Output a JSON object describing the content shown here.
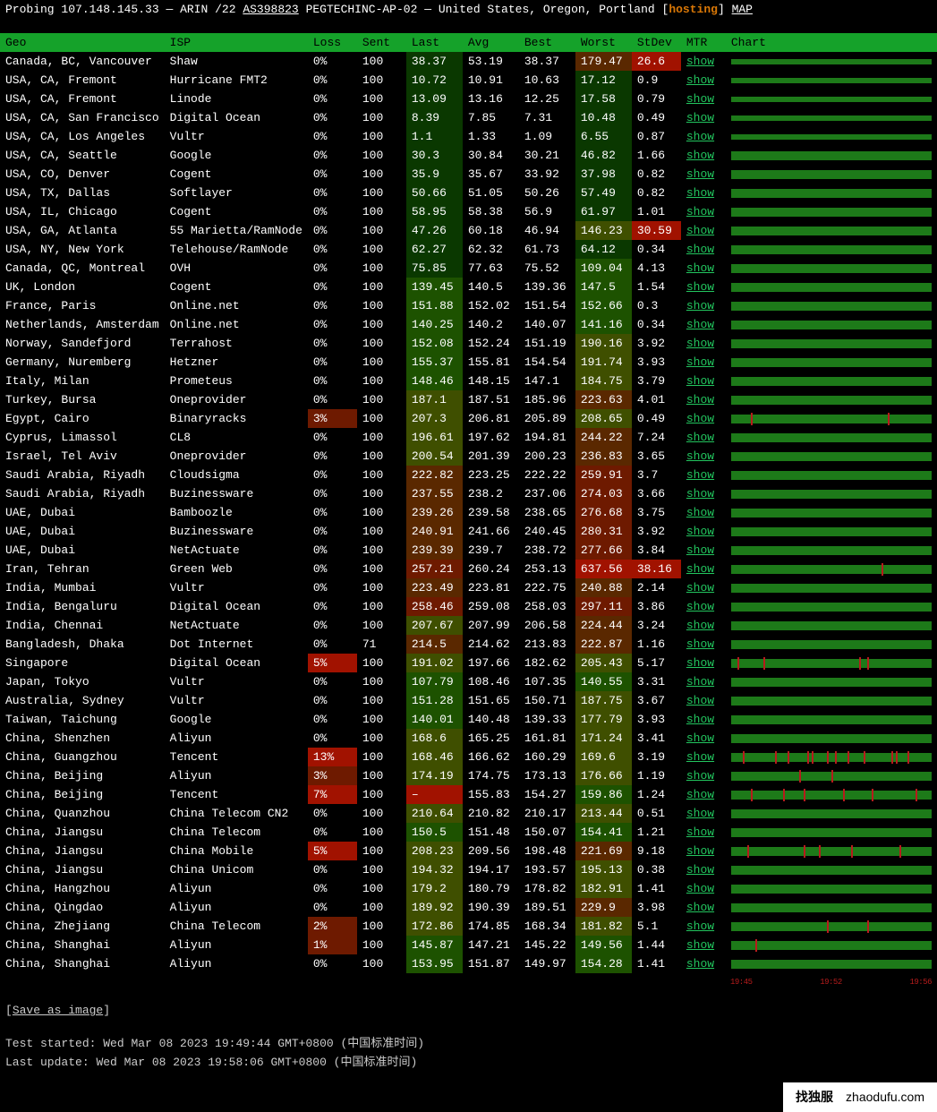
{
  "header": {
    "probing_label": "Probing",
    "ip": "107.148.145.33",
    "dash": "—",
    "rir": "ARIN",
    "prefix": "/22",
    "asn": "AS398823",
    "org": "PEGTECHINC-AP-02",
    "country": "United States",
    "region": "Oregon",
    "city": "Portland",
    "hosting_label": "hosting",
    "map_label": "MAP"
  },
  "columns": {
    "geo": "Geo",
    "isp": "ISP",
    "loss": "Loss",
    "sent": "Sent",
    "last": "Last",
    "avg": "Avg",
    "best": "Best",
    "worst": "Worst",
    "stdev": "StDev",
    "mtr": "MTR",
    "chart": "Chart"
  },
  "mtr_label": "show",
  "rows": [
    {
      "geo": "Canada, BC, Vancouver",
      "isp": "Shaw",
      "loss": "0%",
      "lossh": "h0",
      "sent": "100",
      "last": "38.37",
      "lasth": "h1",
      "avg": "53.19",
      "best": "38.37",
      "worst": "179.47",
      "worsth": "h4",
      "stdev": "26.6",
      "stdevh": "h6",
      "spikes": []
    },
    {
      "geo": "USA, CA, Fremont",
      "isp": "Hurricane FMT2",
      "loss": "0%",
      "lossh": "h0",
      "sent": "100",
      "last": "10.72",
      "lasth": "h1",
      "avg": "10.91",
      "best": "10.63",
      "worst": "17.12",
      "worsth": "h1",
      "stdev": "0.9",
      "stdevh": "h0",
      "spikes": []
    },
    {
      "geo": "USA, CA, Fremont",
      "isp": "Linode",
      "loss": "0%",
      "lossh": "h0",
      "sent": "100",
      "last": "13.09",
      "lasth": "h1",
      "avg": "13.16",
      "best": "12.25",
      "worst": "17.58",
      "worsth": "h1",
      "stdev": "0.79",
      "stdevh": "h0",
      "spikes": []
    },
    {
      "geo": "USA, CA, San Francisco",
      "isp": "Digital Ocean",
      "loss": "0%",
      "lossh": "h0",
      "sent": "100",
      "last": "8.39",
      "lasth": "h1",
      "avg": "7.85",
      "best": "7.31",
      "worst": "10.48",
      "worsth": "h1",
      "stdev": "0.49",
      "stdevh": "h0",
      "spikes": []
    },
    {
      "geo": "USA, CA, Los Angeles",
      "isp": "Vultr",
      "loss": "0%",
      "lossh": "h0",
      "sent": "100",
      "last": "1.1",
      "lasth": "h1",
      "avg": "1.33",
      "best": "1.09",
      "worst": "6.55",
      "worsth": "h1",
      "stdev": "0.87",
      "stdevh": "h0",
      "spikes": []
    },
    {
      "geo": "USA, CA, Seattle",
      "isp": "Google",
      "loss": "0%",
      "lossh": "h0",
      "sent": "100",
      "last": "30.3",
      "lasth": "h1",
      "avg": "30.84",
      "best": "30.21",
      "worst": "46.82",
      "worsth": "h1",
      "stdev": "1.66",
      "stdevh": "h0",
      "spikes": []
    },
    {
      "geo": "USA, CO, Denver",
      "isp": "Cogent",
      "loss": "0%",
      "lossh": "h0",
      "sent": "100",
      "last": "35.9",
      "lasth": "h1",
      "avg": "35.67",
      "best": "33.92",
      "worst": "37.98",
      "worsth": "h1",
      "stdev": "0.82",
      "stdevh": "h0",
      "spikes": []
    },
    {
      "geo": "USA, TX, Dallas",
      "isp": "Softlayer",
      "loss": "0%",
      "lossh": "h0",
      "sent": "100",
      "last": "50.66",
      "lasth": "h1",
      "avg": "51.05",
      "best": "50.26",
      "worst": "57.49",
      "worsth": "h1",
      "stdev": "0.82",
      "stdevh": "h0",
      "spikes": []
    },
    {
      "geo": "USA, IL, Chicago",
      "isp": "Cogent",
      "loss": "0%",
      "lossh": "h0",
      "sent": "100",
      "last": "58.95",
      "lasth": "h1",
      "avg": "58.38",
      "best": "56.9",
      "worst": "61.97",
      "worsth": "h1",
      "stdev": "1.01",
      "stdevh": "h0",
      "spikes": []
    },
    {
      "geo": "USA, GA, Atlanta",
      "isp": "55 Marietta/RamNode",
      "loss": "0%",
      "lossh": "h0",
      "sent": "100",
      "last": "47.26",
      "lasth": "h1",
      "avg": "60.18",
      "best": "46.94",
      "worst": "146.23",
      "worsth": "h3",
      "stdev": "30.59",
      "stdevh": "h6",
      "spikes": []
    },
    {
      "geo": "USA, NY, New York",
      "isp": "Telehouse/RamNode",
      "loss": "0%",
      "lossh": "h0",
      "sent": "100",
      "last": "62.27",
      "lasth": "h1",
      "avg": "62.32",
      "best": "61.73",
      "worst": "64.12",
      "worsth": "h1",
      "stdev": "0.34",
      "stdevh": "h0",
      "spikes": []
    },
    {
      "geo": "Canada, QC, Montreal",
      "isp": "OVH",
      "loss": "0%",
      "lossh": "h0",
      "sent": "100",
      "last": "75.85",
      "lasth": "h1",
      "avg": "77.63",
      "best": "75.52",
      "worst": "109.04",
      "worsth": "h2",
      "stdev": "4.13",
      "stdevh": "h0",
      "spikes": []
    },
    {
      "geo": "UK, London",
      "isp": "Cogent",
      "loss": "0%",
      "lossh": "h0",
      "sent": "100",
      "last": "139.45",
      "lasth": "h2",
      "avg": "140.5",
      "best": "139.36",
      "worst": "147.5",
      "worsth": "h2",
      "stdev": "1.54",
      "stdevh": "h0",
      "spikes": []
    },
    {
      "geo": "France, Paris",
      "isp": "Online.net",
      "loss": "0%",
      "lossh": "h0",
      "sent": "100",
      "last": "151.88",
      "lasth": "h2",
      "avg": "152.02",
      "best": "151.54",
      "worst": "152.66",
      "worsth": "h2",
      "stdev": "0.3",
      "stdevh": "h0",
      "spikes": []
    },
    {
      "geo": "Netherlands, Amsterdam",
      "isp": "Online.net",
      "loss": "0%",
      "lossh": "h0",
      "sent": "100",
      "last": "140.25",
      "lasth": "h2",
      "avg": "140.2",
      "best": "140.07",
      "worst": "141.16",
      "worsth": "h2",
      "stdev": "0.34",
      "stdevh": "h0",
      "spikes": []
    },
    {
      "geo": "Norway, Sandefjord",
      "isp": "Terrahost",
      "loss": "0%",
      "lossh": "h0",
      "sent": "100",
      "last": "152.08",
      "lasth": "h2",
      "avg": "152.24",
      "best": "151.19",
      "worst": "190.16",
      "worsth": "h3",
      "stdev": "3.92",
      "stdevh": "h0",
      "spikes": []
    },
    {
      "geo": "Germany, Nuremberg",
      "isp": "Hetzner",
      "loss": "0%",
      "lossh": "h0",
      "sent": "100",
      "last": "155.37",
      "lasth": "h2",
      "avg": "155.81",
      "best": "154.54",
      "worst": "191.74",
      "worsth": "h3",
      "stdev": "3.93",
      "stdevh": "h0",
      "spikes": []
    },
    {
      "geo": "Italy, Milan",
      "isp": "Prometeus",
      "loss": "0%",
      "lossh": "h0",
      "sent": "100",
      "last": "148.46",
      "lasth": "h2",
      "avg": "148.15",
      "best": "147.1",
      "worst": "184.75",
      "worsth": "h3",
      "stdev": "3.79",
      "stdevh": "h0",
      "spikes": []
    },
    {
      "geo": "Turkey, Bursa",
      "isp": "Oneprovider",
      "loss": "0%",
      "lossh": "h0",
      "sent": "100",
      "last": "187.1",
      "lasth": "h3",
      "avg": "187.51",
      "best": "185.96",
      "worst": "223.63",
      "worsth": "h4",
      "stdev": "4.01",
      "stdevh": "h0",
      "spikes": []
    },
    {
      "geo": "Egypt, Cairo",
      "isp": "Binaryracks",
      "loss": "3%",
      "lossh": "h5",
      "sent": "100",
      "last": "207.3",
      "lasth": "h3",
      "avg": "206.81",
      "best": "205.89",
      "worst": "208.65",
      "worsth": "h3",
      "stdev": "0.49",
      "stdevh": "h0",
      "spikes": [
        10,
        78
      ]
    },
    {
      "geo": "Cyprus, Limassol",
      "isp": "CL8",
      "loss": "0%",
      "lossh": "h0",
      "sent": "100",
      "last": "196.61",
      "lasth": "h3",
      "avg": "197.62",
      "best": "194.81",
      "worst": "244.22",
      "worsth": "h4",
      "stdev": "7.24",
      "stdevh": "h0",
      "spikes": []
    },
    {
      "geo": "Israel, Tel Aviv",
      "isp": "Oneprovider",
      "loss": "0%",
      "lossh": "h0",
      "sent": "100",
      "last": "200.54",
      "lasth": "h3",
      "avg": "201.39",
      "best": "200.23",
      "worst": "236.83",
      "worsth": "h4",
      "stdev": "3.65",
      "stdevh": "h0",
      "spikes": []
    },
    {
      "geo": "Saudi Arabia, Riyadh",
      "isp": "Cloudsigma",
      "loss": "0%",
      "lossh": "h0",
      "sent": "100",
      "last": "222.82",
      "lasth": "h4",
      "avg": "223.25",
      "best": "222.22",
      "worst": "259.91",
      "worsth": "h5",
      "stdev": "3.7",
      "stdevh": "h0",
      "spikes": []
    },
    {
      "geo": "Saudi Arabia, Riyadh",
      "isp": "Buzinessware",
      "loss": "0%",
      "lossh": "h0",
      "sent": "100",
      "last": "237.55",
      "lasth": "h4",
      "avg": "238.2",
      "best": "237.06",
      "worst": "274.03",
      "worsth": "h5",
      "stdev": "3.66",
      "stdevh": "h0",
      "spikes": []
    },
    {
      "geo": "UAE, Dubai",
      "isp": "Bamboozle",
      "loss": "0%",
      "lossh": "h0",
      "sent": "100",
      "last": "239.26",
      "lasth": "h4",
      "avg": "239.58",
      "best": "238.65",
      "worst": "276.68",
      "worsth": "h5",
      "stdev": "3.75",
      "stdevh": "h0",
      "spikes": []
    },
    {
      "geo": "UAE, Dubai",
      "isp": "Buzinessware",
      "loss": "0%",
      "lossh": "h0",
      "sent": "100",
      "last": "240.91",
      "lasth": "h4",
      "avg": "241.66",
      "best": "240.45",
      "worst": "280.31",
      "worsth": "h5",
      "stdev": "3.92",
      "stdevh": "h0",
      "spikes": []
    },
    {
      "geo": "UAE, Dubai",
      "isp": "NetActuate",
      "loss": "0%",
      "lossh": "h0",
      "sent": "100",
      "last": "239.39",
      "lasth": "h4",
      "avg": "239.7",
      "best": "238.72",
      "worst": "277.66",
      "worsth": "h5",
      "stdev": "3.84",
      "stdevh": "h0",
      "spikes": []
    },
    {
      "geo": "Iran, Tehran",
      "isp": "Green Web",
      "loss": "0%",
      "lossh": "h0",
      "sent": "100",
      "last": "257.21",
      "lasth": "h5",
      "avg": "260.24",
      "best": "253.13",
      "worst": "637.56",
      "worsth": "h6",
      "stdev": "38.16",
      "stdevh": "h6",
      "spikes": [
        75
      ]
    },
    {
      "geo": "India, Mumbai",
      "isp": "Vultr",
      "loss": "0%",
      "lossh": "h0",
      "sent": "100",
      "last": "223.49",
      "lasth": "h4",
      "avg": "223.81",
      "best": "222.75",
      "worst": "240.88",
      "worsth": "h4",
      "stdev": "2.14",
      "stdevh": "h0",
      "spikes": []
    },
    {
      "geo": "India, Bengaluru",
      "isp": "Digital Ocean",
      "loss": "0%",
      "lossh": "h0",
      "sent": "100",
      "last": "258.46",
      "lasth": "h5",
      "avg": "259.08",
      "best": "258.03",
      "worst": "297.11",
      "worsth": "h5",
      "stdev": "3.86",
      "stdevh": "h0",
      "spikes": []
    },
    {
      "geo": "India, Chennai",
      "isp": "NetActuate",
      "loss": "0%",
      "lossh": "h0",
      "sent": "100",
      "last": "207.67",
      "lasth": "h3",
      "avg": "207.99",
      "best": "206.58",
      "worst": "224.44",
      "worsth": "h4",
      "stdev": "3.24",
      "stdevh": "h0",
      "spikes": []
    },
    {
      "geo": "Bangladesh, Dhaka",
      "isp": "Dot Internet",
      "loss": "0%",
      "lossh": "h0",
      "sent": "71",
      "last": "214.5",
      "lasth": "h4",
      "avg": "214.62",
      "best": "213.83",
      "worst": "222.87",
      "worsth": "h4",
      "stdev": "1.16",
      "stdevh": "h0",
      "spikes": []
    },
    {
      "geo": "Singapore",
      "isp": "Digital Ocean",
      "loss": "5%",
      "lossh": "h6",
      "sent": "100",
      "last": "191.02",
      "lasth": "h3",
      "avg": "197.66",
      "best": "182.62",
      "worst": "205.43",
      "worsth": "h3",
      "stdev": "5.17",
      "stdevh": "h0",
      "spikes": [
        3,
        16,
        64,
        68
      ]
    },
    {
      "geo": "Japan, Tokyo",
      "isp": "Vultr",
      "loss": "0%",
      "lossh": "h0",
      "sent": "100",
      "last": "107.79",
      "lasth": "h2",
      "avg": "108.46",
      "best": "107.35",
      "worst": "140.55",
      "worsth": "h2",
      "stdev": "3.31",
      "stdevh": "h0",
      "spikes": []
    },
    {
      "geo": "Australia, Sydney",
      "isp": "Vultr",
      "loss": "0%",
      "lossh": "h0",
      "sent": "100",
      "last": "151.28",
      "lasth": "h2",
      "avg": "151.65",
      "best": "150.71",
      "worst": "187.75",
      "worsth": "h3",
      "stdev": "3.67",
      "stdevh": "h0",
      "spikes": []
    },
    {
      "geo": "Taiwan, Taichung",
      "isp": "Google",
      "loss": "0%",
      "lossh": "h0",
      "sent": "100",
      "last": "140.01",
      "lasth": "h2",
      "avg": "140.48",
      "best": "139.33",
      "worst": "177.79",
      "worsth": "h3",
      "stdev": "3.93",
      "stdevh": "h0",
      "spikes": []
    },
    {
      "geo": "China, Shenzhen",
      "isp": "Aliyun",
      "loss": "0%",
      "lossh": "h0",
      "sent": "100",
      "last": "168.6",
      "lasth": "h3",
      "avg": "165.25",
      "best": "161.81",
      "worst": "171.24",
      "worsth": "h3",
      "stdev": "3.41",
      "stdevh": "h0",
      "spikes": []
    },
    {
      "geo": "China, Guangzhou",
      "isp": "Tencent",
      "loss": "13%",
      "lossh": "h6",
      "sent": "100",
      "last": "168.46",
      "lasth": "h3",
      "avg": "166.62",
      "best": "160.29",
      "worst": "169.6",
      "worsth": "h3",
      "stdev": "3.19",
      "stdevh": "h0",
      "spikes": [
        6,
        22,
        28,
        38,
        40,
        48,
        52,
        58,
        66,
        80,
        82,
        88
      ]
    },
    {
      "geo": "China, Beijing",
      "isp": "Aliyun",
      "loss": "3%",
      "lossh": "h5",
      "sent": "100",
      "last": "174.19",
      "lasth": "h3",
      "avg": "174.75",
      "best": "173.13",
      "worst": "176.66",
      "worsth": "h3",
      "stdev": "1.19",
      "stdevh": "h0",
      "spikes": [
        34,
        50
      ]
    },
    {
      "geo": "China, Beijing",
      "isp": "Tencent",
      "loss": "7%",
      "lossh": "h6",
      "sent": "100",
      "last": "–",
      "lasth": "h6",
      "avg": "155.83",
      "best": "154.27",
      "worst": "159.86",
      "worsth": "h2",
      "stdev": "1.24",
      "stdevh": "h0",
      "spikes": [
        10,
        26,
        36,
        56,
        70,
        92
      ]
    },
    {
      "geo": "China, Quanzhou",
      "isp": "China Telecom CN2",
      "loss": "0%",
      "lossh": "h0",
      "sent": "100",
      "last": "210.64",
      "lasth": "h3",
      "avg": "210.82",
      "best": "210.17",
      "worst": "213.44",
      "worsth": "h3",
      "stdev": "0.51",
      "stdevh": "h0",
      "spikes": []
    },
    {
      "geo": "China, Jiangsu",
      "isp": "China Telecom",
      "loss": "0%",
      "lossh": "h0",
      "sent": "100",
      "last": "150.5",
      "lasth": "h2",
      "avg": "151.48",
      "best": "150.07",
      "worst": "154.41",
      "worsth": "h2",
      "stdev": "1.21",
      "stdevh": "h0",
      "spikes": []
    },
    {
      "geo": "China, Jiangsu",
      "isp": "China Mobile",
      "loss": "5%",
      "lossh": "h6",
      "sent": "100",
      "last": "208.23",
      "lasth": "h3",
      "avg": "209.56",
      "best": "198.48",
      "worst": "221.69",
      "worsth": "h4",
      "stdev": "9.18",
      "stdevh": "h0",
      "spikes": [
        8,
        36,
        44,
        60,
        84
      ]
    },
    {
      "geo": "China, Jiangsu",
      "isp": "China Unicom",
      "loss": "0%",
      "lossh": "h0",
      "sent": "100",
      "last": "194.32",
      "lasth": "h3",
      "avg": "194.17",
      "best": "193.57",
      "worst": "195.13",
      "worsth": "h3",
      "stdev": "0.38",
      "stdevh": "h0",
      "spikes": []
    },
    {
      "geo": "China, Hangzhou",
      "isp": "Aliyun",
      "loss": "0%",
      "lossh": "h0",
      "sent": "100",
      "last": "179.2",
      "lasth": "h3",
      "avg": "180.79",
      "best": "178.82",
      "worst": "182.91",
      "worsth": "h3",
      "stdev": "1.41",
      "stdevh": "h0",
      "spikes": []
    },
    {
      "geo": "China, Qingdao",
      "isp": "Aliyun",
      "loss": "0%",
      "lossh": "h0",
      "sent": "100",
      "last": "189.92",
      "lasth": "h3",
      "avg": "190.39",
      "best": "189.51",
      "worst": "229.9",
      "worsth": "h4",
      "stdev": "3.98",
      "stdevh": "h0",
      "spikes": []
    },
    {
      "geo": "China, Zhejiang",
      "isp": "China Telecom",
      "loss": "2%",
      "lossh": "h5",
      "sent": "100",
      "last": "172.86",
      "lasth": "h3",
      "avg": "174.85",
      "best": "168.34",
      "worst": "181.82",
      "worsth": "h3",
      "stdev": "5.1",
      "stdevh": "h0",
      "spikes": [
        48,
        68
      ]
    },
    {
      "geo": "China, Shanghai",
      "isp": "Aliyun",
      "loss": "1%",
      "lossh": "h5",
      "sent": "100",
      "last": "145.87",
      "lasth": "h2",
      "avg": "147.21",
      "best": "145.22",
      "worst": "149.56",
      "worsth": "h2",
      "stdev": "1.44",
      "stdevh": "h0",
      "spikes": [
        12
      ]
    },
    {
      "geo": "China, Shanghai",
      "isp": "Aliyun",
      "loss": "0%",
      "lossh": "h0",
      "sent": "100",
      "last": "153.95",
      "lasth": "h2",
      "avg": "151.87",
      "best": "149.97",
      "worst": "154.28",
      "worsth": "h2",
      "stdev": "1.41",
      "stdevh": "h0",
      "spikes": []
    }
  ],
  "axis_ticks": [
    "19:45",
    "19:52",
    "19:56"
  ],
  "save_label": "Save as image",
  "footer": {
    "started_label": "Test started:",
    "started_val": "Wed Mar 08 2023 19:49:44 GMT+0800 (中国标准时间)",
    "update_label": "Last update:",
    "update_val": "Wed Mar 08 2023 19:58:06 GMT+0800 (中国标准时间)"
  },
  "brand": {
    "cn": "找独服",
    "url": "zhaodufu.com"
  }
}
